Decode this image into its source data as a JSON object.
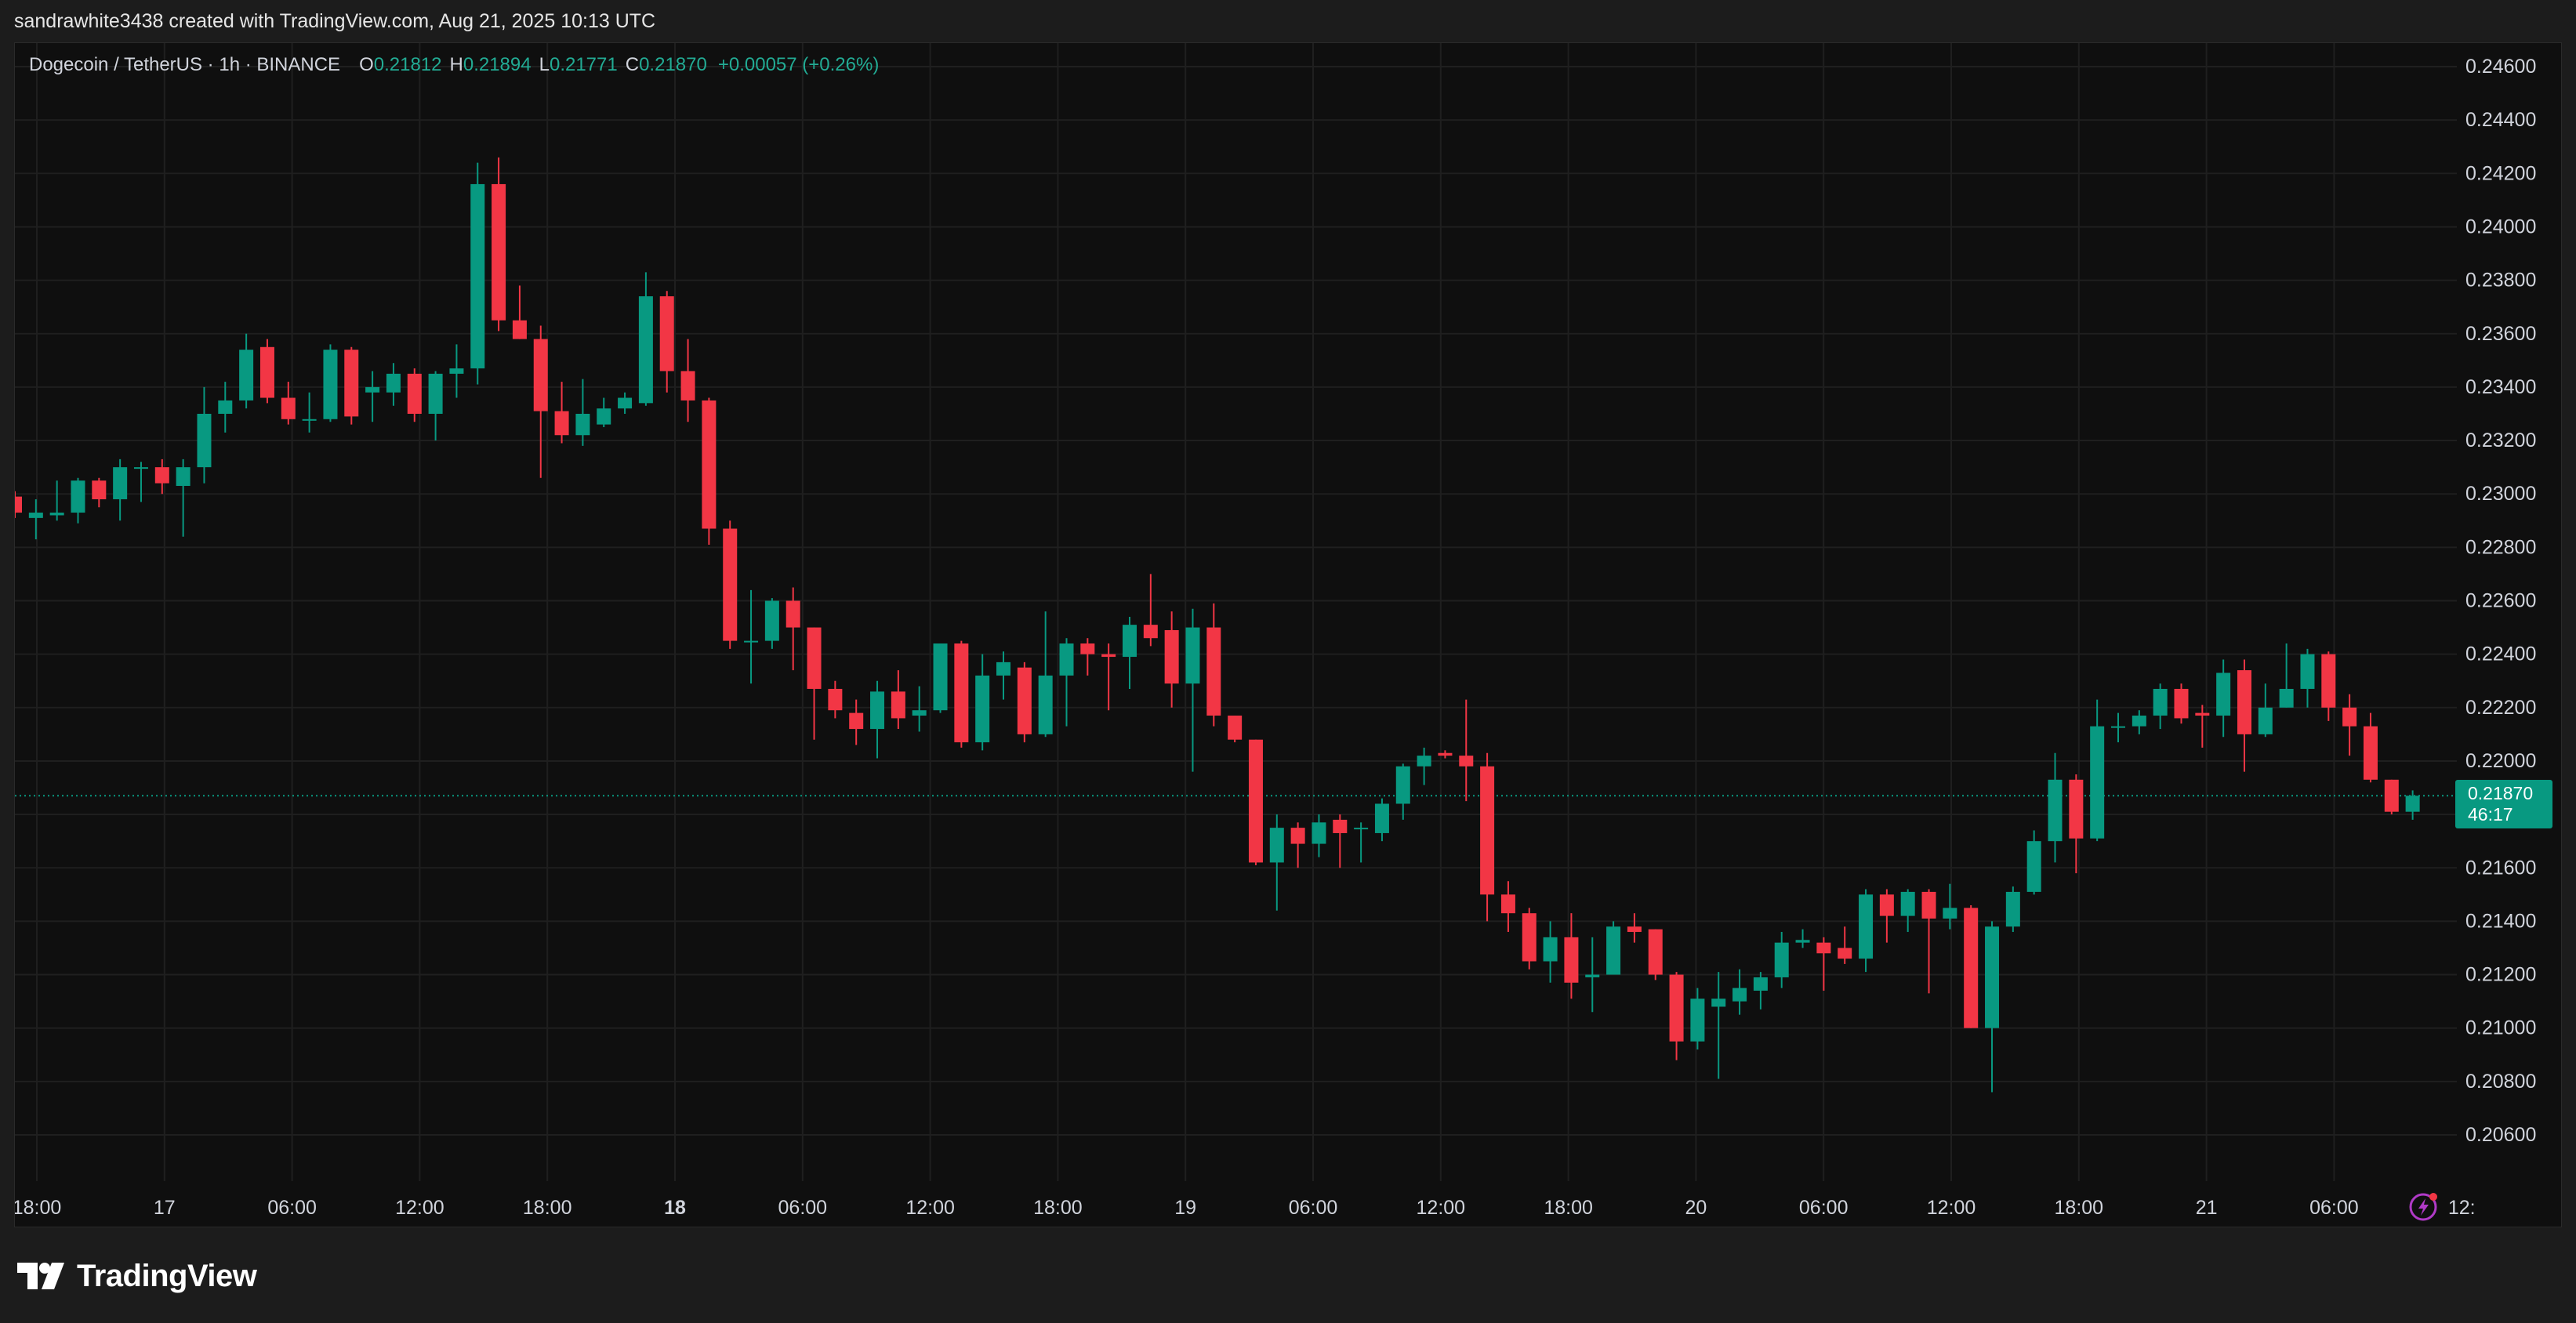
{
  "header": {
    "credit": "sandrawhite3438 created with TradingView.com, Aug 21, 2025 10:13 UTC"
  },
  "legend": {
    "symbol": "Dogecoin / TetherUS · 1h · BINANCE",
    "open_label": "O",
    "open": "0.21812",
    "high_label": "H",
    "high": "0.21894",
    "low_label": "L",
    "low": "0.21771",
    "close_label": "C",
    "close": "0.21870",
    "change": "+0.00057 (+0.26%)"
  },
  "price_tag": {
    "price": "0.21870",
    "countdown": "46:17"
  },
  "brand": {
    "name": "TradingView"
  },
  "icons": {
    "logo": "tradingview-logo-icon",
    "bolt": "lightning-bolt-icon"
  },
  "colors": {
    "up": "#089981",
    "down": "#f23645",
    "background": "#0f0f0f",
    "grid": "#1f1f1f",
    "axis_text": "#d1d4dc",
    "bolt": "#b03ac7"
  },
  "chart_data": {
    "type": "candlestick",
    "timeframe": "1h",
    "ylim": [
      0.205,
      0.247
    ],
    "y_ticks": [
      "0.24600",
      "0.24400",
      "0.24200",
      "0.24000",
      "0.23800",
      "0.23600",
      "0.23400",
      "0.23200",
      "0.23000",
      "0.22800",
      "0.22600",
      "0.22400",
      "0.22200",
      "0.22000",
      "0.21800",
      "0.21600",
      "0.21400",
      "0.21200",
      "0.21000",
      "0.20800",
      "0.20600"
    ],
    "x_ticks": [
      {
        "label": "18:00",
        "bold": false
      },
      {
        "label": "17",
        "bold": false
      },
      {
        "label": "06:00",
        "bold": false
      },
      {
        "label": "12:00",
        "bold": false
      },
      {
        "label": "18:00",
        "bold": false
      },
      {
        "label": "18",
        "bold": true
      },
      {
        "label": "06:00",
        "bold": false
      },
      {
        "label": "12:00",
        "bold": false
      },
      {
        "label": "18:00",
        "bold": false
      },
      {
        "label": "19",
        "bold": false
      },
      {
        "label": "06:00",
        "bold": false
      },
      {
        "label": "12:00",
        "bold": false
      },
      {
        "label": "18:00",
        "bold": false
      },
      {
        "label": "20",
        "bold": false
      },
      {
        "label": "06:00",
        "bold": false
      },
      {
        "label": "12:00",
        "bold": false
      },
      {
        "label": "18:00",
        "bold": false
      },
      {
        "label": "21",
        "bold": false
      },
      {
        "label": "06:00",
        "bold": false
      },
      {
        "label": "12:",
        "bold": false
      }
    ],
    "current_price": 0.2187,
    "candles": [
      [
        0.2299,
        0.2301,
        0.2291,
        0.2293
      ],
      [
        0.2291,
        0.2298,
        0.2283,
        0.2293
      ],
      [
        0.2292,
        0.2305,
        0.229,
        0.2293
      ],
      [
        0.2293,
        0.2306,
        0.2289,
        0.2305
      ],
      [
        0.2305,
        0.2306,
        0.2295,
        0.2298
      ],
      [
        0.2298,
        0.2313,
        0.229,
        0.231
      ],
      [
        0.231,
        0.2312,
        0.2297,
        0.231
      ],
      [
        0.231,
        0.2313,
        0.23,
        0.2304
      ],
      [
        0.2303,
        0.2313,
        0.2284,
        0.231
      ],
      [
        0.231,
        0.234,
        0.2304,
        0.233
      ],
      [
        0.233,
        0.2342,
        0.2323,
        0.2335
      ],
      [
        0.2335,
        0.236,
        0.2332,
        0.2354
      ],
      [
        0.2355,
        0.2358,
        0.2334,
        0.2336
      ],
      [
        0.2336,
        0.2342,
        0.2326,
        0.2328
      ],
      [
        0.2328,
        0.2338,
        0.2323,
        0.2328
      ],
      [
        0.2328,
        0.2356,
        0.2327,
        0.2354
      ],
      [
        0.2354,
        0.2355,
        0.2326,
        0.2329
      ],
      [
        0.2338,
        0.2346,
        0.2327,
        0.234
      ],
      [
        0.2338,
        0.2349,
        0.2333,
        0.2345
      ],
      [
        0.2345,
        0.2347,
        0.2327,
        0.233
      ],
      [
        0.233,
        0.2346,
        0.232,
        0.2345
      ],
      [
        0.2345,
        0.2356,
        0.2336,
        0.2347
      ],
      [
        0.2347,
        0.2424,
        0.2341,
        0.2416
      ],
      [
        0.2416,
        0.2426,
        0.2361,
        0.2365
      ],
      [
        0.2365,
        0.2378,
        0.2358,
        0.2358
      ],
      [
        0.2358,
        0.2363,
        0.2306,
        0.2331
      ],
      [
        0.2331,
        0.2342,
        0.2319,
        0.2322
      ],
      [
        0.2322,
        0.2343,
        0.2318,
        0.233
      ],
      [
        0.2326,
        0.2336,
        0.2325,
        0.2332
      ],
      [
        0.2332,
        0.2338,
        0.233,
        0.2336
      ],
      [
        0.2334,
        0.2383,
        0.2333,
        0.2374
      ],
      [
        0.2374,
        0.2376,
        0.2338,
        0.2346
      ],
      [
        0.2346,
        0.2358,
        0.2327,
        0.2335
      ],
      [
        0.2335,
        0.2336,
        0.2281,
        0.2287
      ],
      [
        0.2287,
        0.229,
        0.2242,
        0.2245
      ],
      [
        0.2245,
        0.2264,
        0.2229,
        0.2245
      ],
      [
        0.2245,
        0.2261,
        0.2242,
        0.226
      ],
      [
        0.226,
        0.2265,
        0.2234,
        0.225
      ],
      [
        0.225,
        0.225,
        0.2208,
        0.2227
      ],
      [
        0.2227,
        0.223,
        0.2216,
        0.2219
      ],
      [
        0.2218,
        0.2223,
        0.2206,
        0.2212
      ],
      [
        0.2212,
        0.223,
        0.2201,
        0.2226
      ],
      [
        0.2226,
        0.2234,
        0.2212,
        0.2216
      ],
      [
        0.2217,
        0.2228,
        0.2211,
        0.2219
      ],
      [
        0.2219,
        0.2244,
        0.2218,
        0.2244
      ],
      [
        0.2244,
        0.2245,
        0.2205,
        0.2207
      ],
      [
        0.2207,
        0.224,
        0.2204,
        0.2232
      ],
      [
        0.2232,
        0.2241,
        0.2223,
        0.2237
      ],
      [
        0.2235,
        0.2237,
        0.2207,
        0.221
      ],
      [
        0.221,
        0.2256,
        0.2209,
        0.2232
      ],
      [
        0.2232,
        0.2246,
        0.2213,
        0.2244
      ],
      [
        0.2244,
        0.2246,
        0.2232,
        0.224
      ],
      [
        0.224,
        0.2244,
        0.2219,
        0.2239
      ],
      [
        0.2239,
        0.2254,
        0.2227,
        0.2251
      ],
      [
        0.2251,
        0.227,
        0.2243,
        0.2246
      ],
      [
        0.2249,
        0.2256,
        0.222,
        0.2229
      ],
      [
        0.2229,
        0.2257,
        0.2196,
        0.225
      ],
      [
        0.225,
        0.2259,
        0.2213,
        0.2217
      ],
      [
        0.2217,
        0.2217,
        0.2207,
        0.2208
      ],
      [
        0.2208,
        0.2208,
        0.2161,
        0.2162
      ],
      [
        0.2162,
        0.218,
        0.2144,
        0.2175
      ],
      [
        0.2175,
        0.2177,
        0.216,
        0.2169
      ],
      [
        0.2169,
        0.218,
        0.2164,
        0.2177
      ],
      [
        0.2178,
        0.218,
        0.216,
        0.2173
      ],
      [
        0.2175,
        0.2177,
        0.2162,
        0.2175
      ],
      [
        0.2173,
        0.2186,
        0.217,
        0.2184
      ],
      [
        0.2184,
        0.2199,
        0.2178,
        0.2198
      ],
      [
        0.2198,
        0.2205,
        0.2191,
        0.2202
      ],
      [
        0.2203,
        0.2204,
        0.2201,
        0.2202
      ],
      [
        0.2202,
        0.2223,
        0.2185,
        0.2198
      ],
      [
        0.2198,
        0.2203,
        0.214,
        0.215
      ],
      [
        0.215,
        0.2155,
        0.2136,
        0.2143
      ],
      [
        0.2143,
        0.2145,
        0.2122,
        0.2125
      ],
      [
        0.2125,
        0.214,
        0.2117,
        0.2134
      ],
      [
        0.2134,
        0.2143,
        0.2111,
        0.2117
      ],
      [
        0.2119,
        0.2134,
        0.2106,
        0.212
      ],
      [
        0.212,
        0.214,
        0.212,
        0.2138
      ],
      [
        0.2138,
        0.2143,
        0.2132,
        0.2136
      ],
      [
        0.2137,
        0.2137,
        0.2118,
        0.212
      ],
      [
        0.212,
        0.2121,
        0.2088,
        0.2095
      ],
      [
        0.2095,
        0.2115,
        0.2092,
        0.2111
      ],
      [
        0.2108,
        0.2121,
        0.2081,
        0.2111
      ],
      [
        0.211,
        0.2122,
        0.2105,
        0.2115
      ],
      [
        0.2114,
        0.2121,
        0.2107,
        0.2119
      ],
      [
        0.2119,
        0.2136,
        0.2115,
        0.2132
      ],
      [
        0.2132,
        0.2137,
        0.213,
        0.2133
      ],
      [
        0.2132,
        0.2134,
        0.2114,
        0.2128
      ],
      [
        0.213,
        0.2138,
        0.2124,
        0.2126
      ],
      [
        0.2126,
        0.2152,
        0.2121,
        0.215
      ],
      [
        0.215,
        0.2152,
        0.2132,
        0.2142
      ],
      [
        0.2142,
        0.2152,
        0.2136,
        0.2151
      ],
      [
        0.2151,
        0.2152,
        0.2113,
        0.2141
      ],
      [
        0.2141,
        0.2154,
        0.2137,
        0.2145
      ],
      [
        0.2145,
        0.2146,
        0.21,
        0.21
      ],
      [
        0.21,
        0.214,
        0.2076,
        0.2138
      ],
      [
        0.2138,
        0.2153,
        0.2136,
        0.2151
      ],
      [
        0.2151,
        0.2174,
        0.215,
        0.217
      ],
      [
        0.217,
        0.2203,
        0.2162,
        0.2193
      ],
      [
        0.2193,
        0.2195,
        0.2158,
        0.2171
      ],
      [
        0.2171,
        0.2223,
        0.217,
        0.2213
      ],
      [
        0.2213,
        0.2218,
        0.2207,
        0.2213
      ],
      [
        0.2213,
        0.2219,
        0.221,
        0.2217
      ],
      [
        0.2217,
        0.2229,
        0.2212,
        0.2227
      ],
      [
        0.2227,
        0.2229,
        0.2214,
        0.2216
      ],
      [
        0.2218,
        0.2221,
        0.2205,
        0.2217
      ],
      [
        0.2217,
        0.2238,
        0.2209,
        0.2233
      ],
      [
        0.2234,
        0.2238,
        0.2196,
        0.221
      ],
      [
        0.221,
        0.2229,
        0.2209,
        0.222
      ],
      [
        0.222,
        0.2244,
        0.222,
        0.2227
      ],
      [
        0.2227,
        0.2242,
        0.222,
        0.224
      ],
      [
        0.224,
        0.2241,
        0.2215,
        0.222
      ],
      [
        0.222,
        0.2225,
        0.2202,
        0.2213
      ],
      [
        0.2213,
        0.2218,
        0.2192,
        0.2193
      ],
      [
        0.2193,
        0.2193,
        0.218,
        0.2181
      ],
      [
        0.2181,
        0.2189,
        0.2178,
        0.2187
      ]
    ]
  }
}
